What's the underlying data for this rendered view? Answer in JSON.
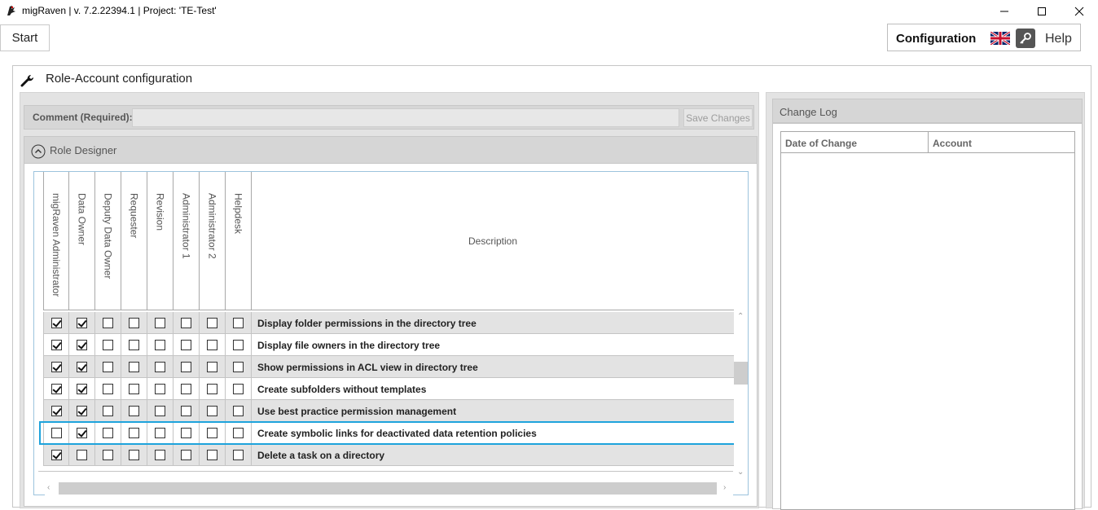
{
  "window": {
    "title": "migRaven | v. 7.2.22394.1 | Project: 'TE-Test'"
  },
  "topbar": {
    "start_label": "Start",
    "config_label": "Configuration",
    "help_label": "Help",
    "language_icon": "uk-flag-icon",
    "key_icon": "key-icon"
  },
  "page": {
    "title": "Role-Account configuration"
  },
  "comment": {
    "label": "Comment (Required):",
    "value": "",
    "save_label": "Save Changes"
  },
  "role_designer": {
    "title": "Role Designer",
    "columns": [
      "migRaven Administrator",
      "Data Owner",
      "Deputy Data Owner",
      "Requester",
      "Revision",
      "Administrator 1",
      "Administrator 2",
      "Helpdesk"
    ],
    "description_header": "Description",
    "rows": [
      {
        "description": "Display folder permissions in the directory tree",
        "checks": [
          true,
          true,
          false,
          false,
          false,
          false,
          false,
          false
        ]
      },
      {
        "description": "Display file owners in the directory tree",
        "checks": [
          true,
          true,
          false,
          false,
          false,
          false,
          false,
          false
        ]
      },
      {
        "description": "Show permissions in ACL view in directory tree",
        "checks": [
          true,
          true,
          false,
          false,
          false,
          false,
          false,
          false
        ]
      },
      {
        "description": "Create subfolders without templates",
        "checks": [
          true,
          true,
          false,
          false,
          false,
          false,
          false,
          false
        ]
      },
      {
        "description": "Use best practice permission management",
        "checks": [
          true,
          true,
          false,
          false,
          false,
          false,
          false,
          false
        ]
      },
      {
        "description": "Create symbolic links for deactivated data retention policies",
        "checks": [
          false,
          true,
          false,
          false,
          false,
          false,
          false,
          false
        ]
      },
      {
        "description": "Delete a task on a directory",
        "checks": [
          true,
          false,
          false,
          false,
          false,
          false,
          false,
          false
        ]
      }
    ],
    "selected_row": 5
  },
  "change_log": {
    "title": "Change Log",
    "columns": [
      "Date of Change",
      "Account"
    ]
  },
  "colors": {
    "selection": "#1ea3dc",
    "panel": "#e3e3e3",
    "header": "#d6d6d6"
  }
}
